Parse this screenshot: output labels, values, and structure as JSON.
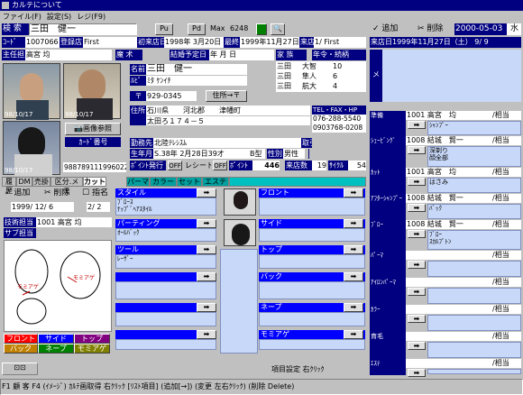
{
  "window": {
    "title": "カルテについて"
  },
  "menu": [
    "ファイル(F)",
    "設定(S)",
    "レジ(F9)"
  ],
  "search": {
    "label": "検 索",
    "name": "三田　健一",
    "pu": "Pu",
    "pd": "Pd",
    "max_label": "Max",
    "max_value": "6248"
  },
  "toolbar_right": {
    "add": "追加",
    "delete": "削除",
    "date": "2000-05-03",
    "weekday": "水"
  },
  "record": {
    "code_label": "ｺｰﾄﾞ",
    "code": "1007066",
    "store_label": "登録店",
    "store": "First",
    "first_visit_label": "初来店日",
    "first_visit": "1998年 3月20日",
    "last_visit_label": "最終日",
    "last_visit": "1999年11月27日",
    "visit_store_label": "来店",
    "visit_store": "1/ First"
  },
  "staff": {
    "main_label": "主任担当",
    "main": "高宮 均",
    "memo_label": "魔 术",
    "wedding_label": "結婚予定日",
    "wedding": "  年  月  日",
    "family_label": "家 族",
    "age_label": "年令・続柄"
  },
  "photos": [
    {
      "date": "98/10/17"
    },
    {
      "date": "98/10/17"
    },
    {
      "date": "98/10/17"
    }
  ],
  "photo_ref": "画像参照",
  "card": {
    "label": "ｶｰﾄﾞ番号",
    "number": "9887891119960229"
  },
  "customer": {
    "name_label": "名前",
    "name": "三田　健一",
    "ruby_label": "ﾙﾋﾞ",
    "ruby": "ﾐﾀ ｹﾝｲﾁ",
    "zip_label": "〒",
    "zip": "929-0345",
    "addr_btn": "住所→〒",
    "addr_label": "住所",
    "addr1": "石川県　　河北郡　　津幡町",
    "addr2": "太田ろ１７４－５",
    "tel_label": "TEL・FAX・HP",
    "tel1": "076-288-5540",
    "tel2": "0903768-0208",
    "work_label": "勤務先",
    "work": "北陸ﾃﾚｼｽﾑ",
    "birth_label": "生年月日",
    "birth": "S.38年 2月28日39才",
    "blood": "B型",
    "sex_label": "性別",
    "sex": "男性",
    "shop_label": "取引店",
    "point_label": "ﾎﾟｲﾝﾄ発行",
    "off1": "OFF",
    "card_label": "レシート",
    "off2": "OFF",
    "point_label2": "ﾎﾟｲﾝﾄ",
    "points": "446",
    "visits_label": "来店数",
    "visits": "19",
    "cycle_label": "ｻｲｸﾙ",
    "cycle": "54"
  },
  "family": [
    {
      "name": "三田",
      "rel": "大智",
      "age": "10"
    },
    {
      "name": "三田",
      "rel": "隼人",
      "age": "6"
    },
    {
      "name": "三田",
      "rel": "航大",
      "age": "4"
    }
  ],
  "memo_label": "メモ",
  "right_store": {
    "label": "来店日",
    "date": "1999年11月27日（土）",
    "n1": "9",
    "n2": "9"
  },
  "tabs": [
    "履歴",
    "DM",
    "売掛",
    "区分.メモ",
    "カット",
    "パーマ",
    "カラー",
    "セット",
    "エステ"
  ],
  "karte": {
    "add": "追加",
    "delete": "削除",
    "name_chk": "指名",
    "date": "1999/ 12/ 6",
    "time": "2/ 2",
    "staff_label": "技術担当",
    "staff": "1001 高宮 均",
    "sub_label": "サブ担当"
  },
  "head_labels": [
    "モミアゲ",
    "モミアゲ"
  ],
  "color_btns": [
    "フロント",
    "サイド",
    "トップ",
    "バック",
    "ネープ",
    "モミアゲ"
  ],
  "cut_sections": [
    {
      "title": "スタイル",
      "value": "ﾌﾞﾛｰｽ\nﾅｯﾌﾟﾞﾍｱｽﾀｲﾙ"
    },
    {
      "title": "パーティング",
      "value": "ｵｰﾙﾊﾞｯｸ"
    },
    {
      "title": "ツール",
      "value": "ﾚｰｻﾞｰ"
    },
    {
      "title": "",
      "value": ""
    },
    {
      "title": "",
      "value": ""
    },
    {
      "title": "",
      "value": ""
    }
  ],
  "cut_sections_r": [
    "フロント",
    "サイド",
    "トップ",
    "バック",
    "ネープ",
    "モミアゲ"
  ],
  "services": [
    {
      "label": "準備",
      "code": "1001",
      "staff": "高宮　均",
      "role": "/相当",
      "item": "ｼｬﾝﾌﾟｰ"
    },
    {
      "label": "ｼｪｰﾋﾞﾝｸﾞ",
      "code": "1008",
      "staff": "結城　賢一",
      "role": "/相当",
      "item": "深剃り\n顔全部"
    },
    {
      "label": "ｶｯﾄ",
      "code": "1001",
      "staff": "高宮　均",
      "role": "/相当",
      "item": "はさみ"
    },
    {
      "label": "ｱﾌﾀｰｼｬﾝﾌﾟｰ",
      "code": "1008",
      "staff": "結城　賢一",
      "role": "/相当",
      "item": "ﾊﾞｯｸ"
    },
    {
      "label": "ﾌﾞﾛｰ",
      "code": "1008",
      "staff": "結城　賢一",
      "role": "/相当",
      "item": "ﾌﾞﾛｰ\nｽｶﾙﾌﾟﾄﾝ"
    },
    {
      "label": "ﾊﾟｰﾏ",
      "code": "",
      "staff": "",
      "role": "/相当",
      "item": ""
    },
    {
      "label": "ｱｲﾛﾝﾊﾟｰﾏ",
      "code": "",
      "staff": "",
      "role": "/相当",
      "item": ""
    },
    {
      "label": "ｶﾗｰ",
      "code": "",
      "staff": "",
      "role": "/相当",
      "item": ""
    },
    {
      "label": "育毛",
      "code": "",
      "staff": "",
      "role": "/相当",
      "item": ""
    },
    {
      "label": "ｴｽﾃ",
      "code": "",
      "staff": "",
      "role": "/相当",
      "item": ""
    }
  ],
  "footer": {
    "item_set": "項目設定 右ｸﾘｯｸ",
    "status": "F1 顧 客  F4 (ｲﾒｰｼﾞ) ｶﾙﾃ画取得 右ｸﾘｯｸ [ﾘｽﾄ項目] (追加[→]) (変更 左右ｸﾘｯｸ) (削除 Delete)"
  }
}
